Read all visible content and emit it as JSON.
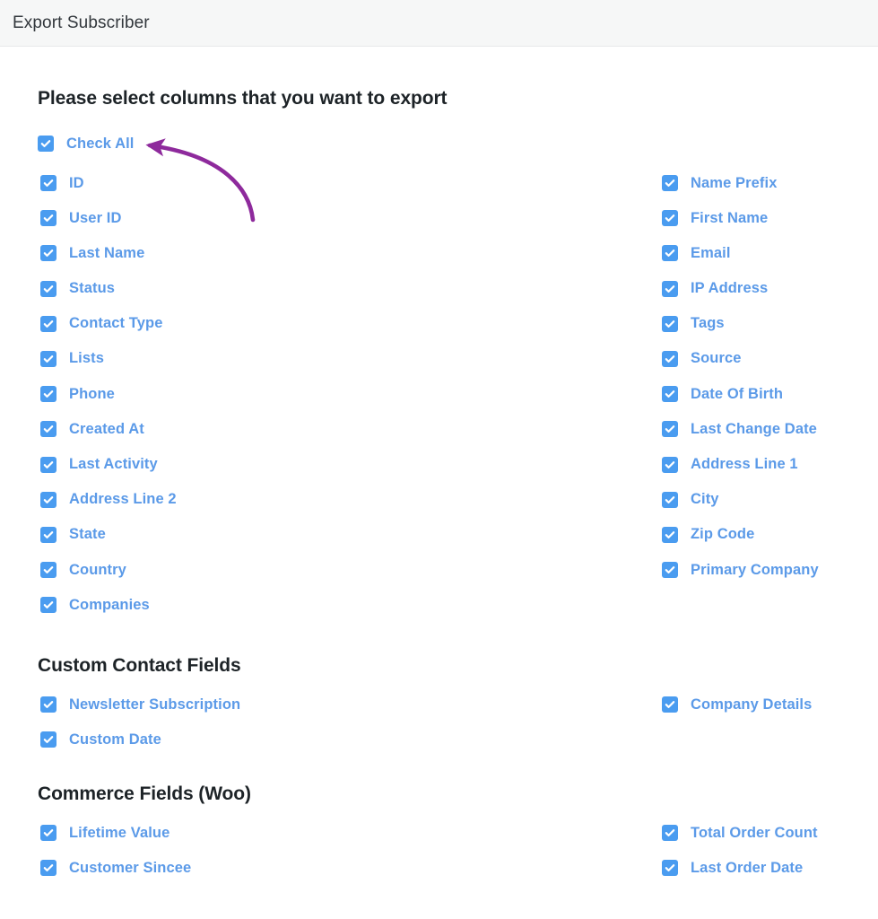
{
  "header": {
    "title": "Export Subscriber"
  },
  "main": {
    "heading": "Please select columns that you want to export",
    "check_all": {
      "label": "Check All",
      "checked": true
    },
    "columns": {
      "left": [
        "ID",
        "User ID",
        "Last Name",
        "Status",
        "Contact Type",
        "Lists",
        "Phone",
        "Created At",
        "Last Activity",
        "Address Line 2",
        "State",
        "Country",
        "Companies"
      ],
      "right": [
        "Name Prefix",
        "First Name",
        "Email",
        "IP Address",
        "Tags",
        "Source",
        "Date Of Birth",
        "Last Change Date",
        "Address Line 1",
        "City",
        "Zip Code",
        "Primary Company"
      ]
    }
  },
  "custom_contact_fields": {
    "heading": "Custom Contact Fields",
    "left": [
      "Newsletter Subscription",
      "Custom Date"
    ],
    "right": [
      "Company Details"
    ]
  },
  "commerce_fields": {
    "heading": "Commerce Fields (Woo)",
    "left": [
      "Lifetime Value",
      "Customer Sincee"
    ],
    "right": [
      "Total Order Count",
      "Last Order Date"
    ]
  },
  "annotation": {
    "type": "curved-arrow",
    "color": "#8e2a9c",
    "points_to": "Check All"
  },
  "colors": {
    "checkbox_fill": "#4a9cf0",
    "label_text": "#5b9ae8",
    "heading_text": "#1d2327",
    "header_bg": "#f6f7f7",
    "annotation": "#8e2a9c"
  },
  "icons": {
    "checkmark": "check-icon"
  }
}
